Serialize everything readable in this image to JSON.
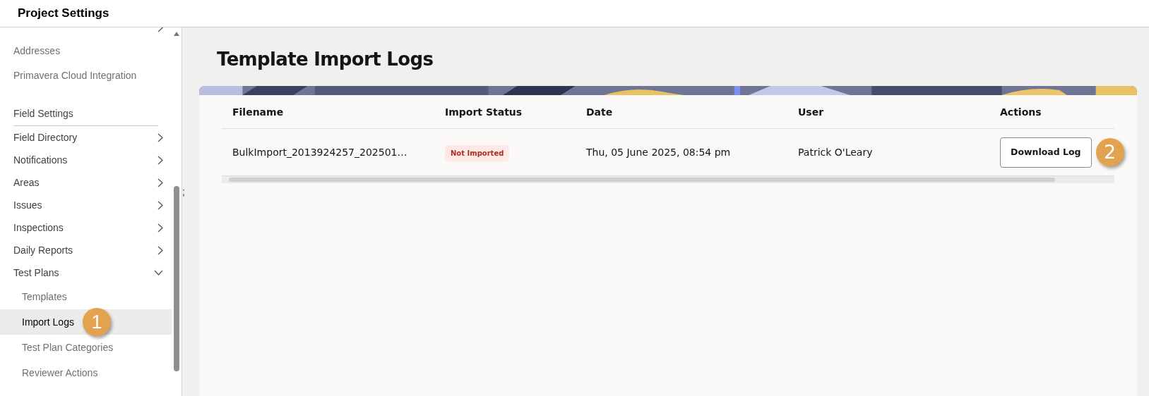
{
  "header": {
    "title": "Project Settings"
  },
  "sidebar": {
    "items": [
      {
        "kind": "group",
        "expanded": false,
        "selected": false
      },
      {
        "kind": "link",
        "label": "Addresses",
        "selected": false
      },
      {
        "kind": "link",
        "label": "Primavera Cloud Integration",
        "selected": false
      },
      {
        "kind": "section",
        "label": "Field Settings"
      },
      {
        "kind": "group",
        "label": "Field Directory",
        "expanded": false,
        "selected": false
      },
      {
        "kind": "group",
        "label": "Notifications",
        "expanded": false,
        "selected": false
      },
      {
        "kind": "group",
        "label": "Areas",
        "expanded": false,
        "selected": false
      },
      {
        "kind": "group",
        "label": "Issues",
        "expanded": false,
        "selected": false
      },
      {
        "kind": "group",
        "label": "Inspections",
        "expanded": false,
        "selected": false
      },
      {
        "kind": "group",
        "label": "Daily Reports",
        "expanded": false,
        "selected": false
      },
      {
        "kind": "group",
        "label": "Test Plans",
        "expanded": true,
        "selected": false
      },
      {
        "kind": "sub",
        "label": "Templates",
        "selected": false
      },
      {
        "kind": "sub",
        "label": "Import Logs",
        "selected": true,
        "annotation": "1"
      },
      {
        "kind": "sub",
        "label": "Test Plan Categories",
        "selected": false
      },
      {
        "kind": "sub",
        "label": "Reviewer Actions",
        "selected": false
      }
    ]
  },
  "page": {
    "title": "Template Import Logs",
    "stray_text": ";"
  },
  "table": {
    "columns": [
      "Filename",
      "Import Status",
      "Date",
      "User",
      "Actions"
    ],
    "rows": [
      {
        "filename": "BulkImport_2013924257_202501…",
        "status": "Not Imported",
        "date": "Thu, 05 June 2025, 08:54 pm",
        "user": "Patrick O'Leary",
        "action": "Download Log",
        "annotation": "2"
      }
    ]
  }
}
